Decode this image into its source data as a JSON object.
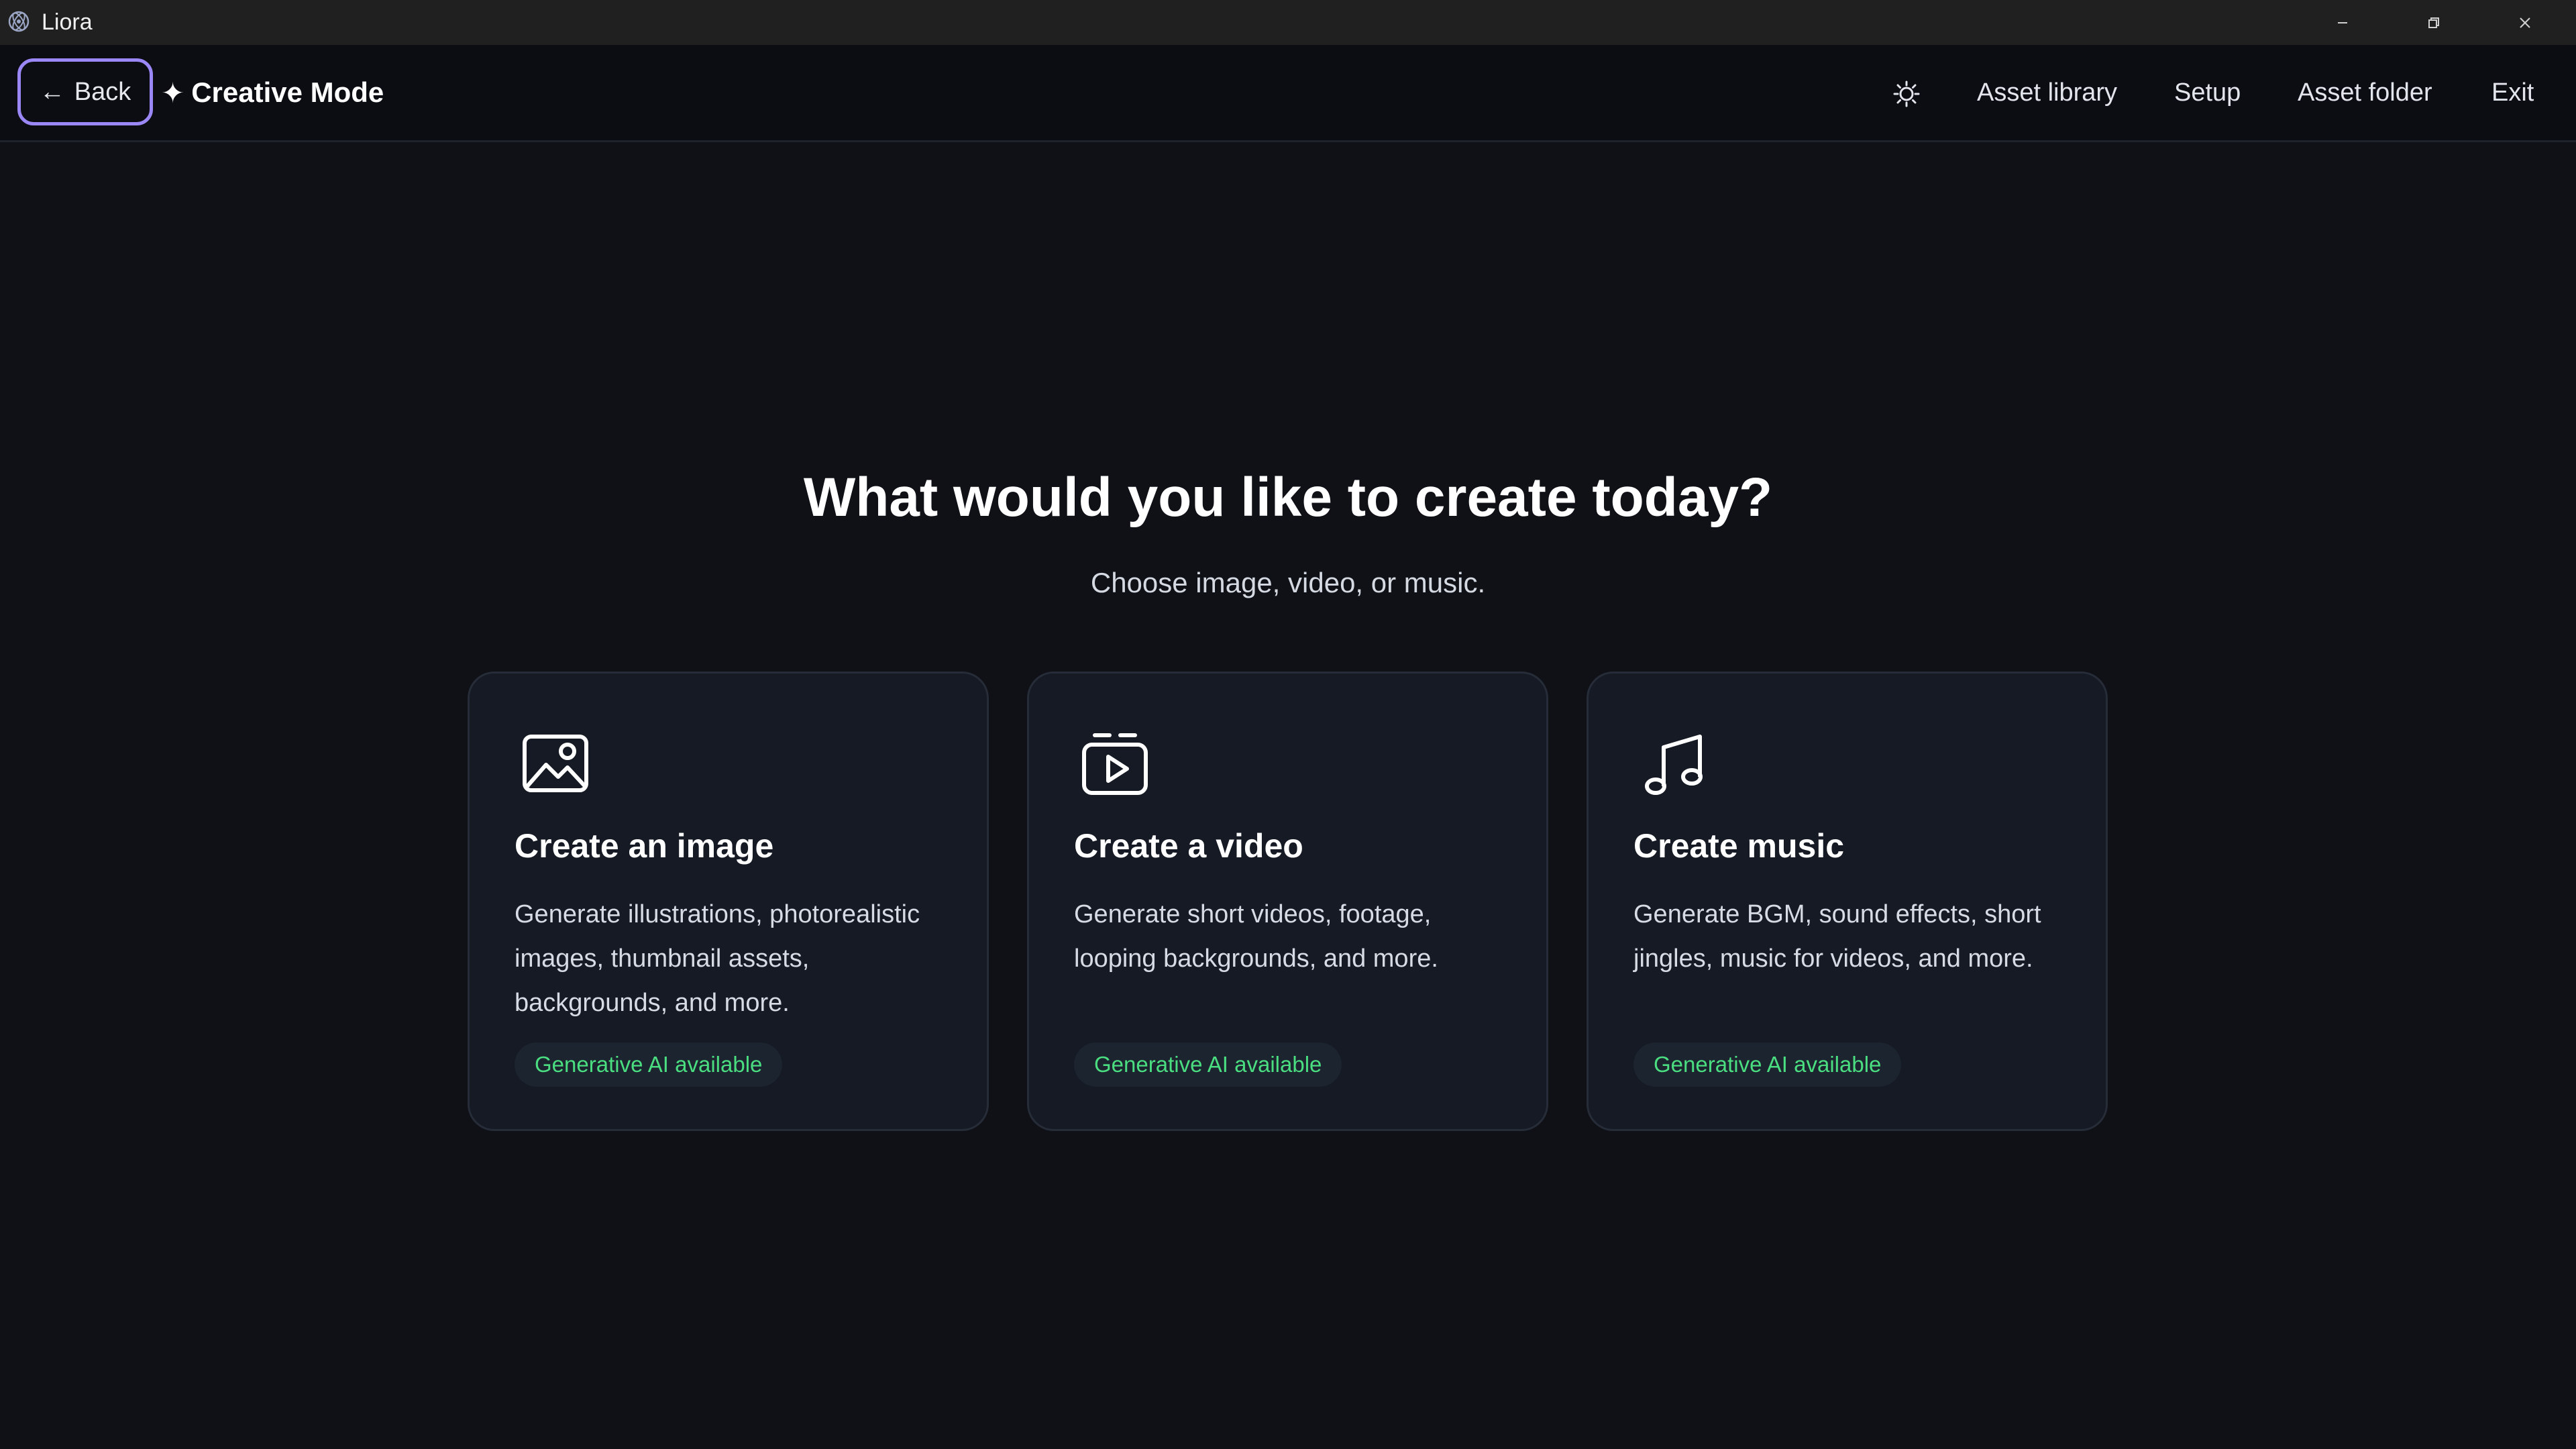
{
  "window": {
    "title": "Liora"
  },
  "topnav": {
    "back_label": "Back",
    "back_arrow": "←",
    "mode_icon": "✦",
    "mode_title": "Creative Mode",
    "links": [
      "Asset library",
      "Setup",
      "Asset folder",
      "Exit"
    ]
  },
  "hero": {
    "title": "What would you like to create today?",
    "subtitle": "Choose image, video, or music."
  },
  "cards": [
    {
      "icon": "image-icon",
      "title": "Create an image",
      "description": "Generate illustrations, photorealistic images, thumbnail assets, backgrounds, and more.",
      "badge": "Generative AI available"
    },
    {
      "icon": "video-icon",
      "title": "Create a video",
      "description": "Generate short videos, footage, looping backgrounds, and more.",
      "badge": "Generative AI available"
    },
    {
      "icon": "music-icon",
      "title": "Create music",
      "description": "Generate BGM, sound effects, short jingles, music for videos, and more.",
      "badge": "Generative AI available"
    }
  ],
  "colors": {
    "background": "#0f1117",
    "card": "#151a24",
    "accent_border": "#9b87f5",
    "badge_text": "#4ade80"
  }
}
